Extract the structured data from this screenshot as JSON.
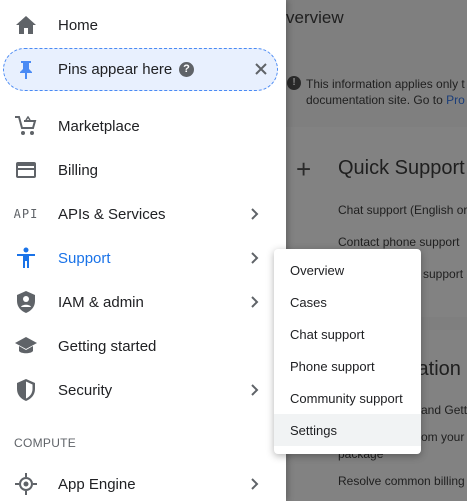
{
  "background": {
    "page_title": "verview",
    "info_line1": "This information applies only t",
    "info_line2": "documentation site. Go to",
    "info_link": "Pro",
    "quick_support_title": "Quick Support",
    "lines": [
      "Chat support (English or",
      "Contact phone support",
      "support",
      "and Gett",
      "om your C",
      "package",
      "Resolve common billing"
    ],
    "doc_title": "tation"
  },
  "sidebar": {
    "items_top": [
      {
        "label": "Home",
        "icon": "home-icon"
      }
    ],
    "pins": {
      "label": "Pins appear here",
      "help": "?",
      "close": "×"
    },
    "items": [
      {
        "label": "Marketplace",
        "icon": "cart-icon",
        "chevron": false
      },
      {
        "label": "Billing",
        "icon": "billing-icon",
        "chevron": false
      },
      {
        "label": "APIs & Services",
        "icon": "api-icon",
        "chevron": true
      },
      {
        "label": "Support",
        "icon": "support-icon",
        "chevron": true,
        "active": true
      },
      {
        "label": "IAM & admin",
        "icon": "iam-shield-icon",
        "chevron": true
      },
      {
        "label": "Getting started",
        "icon": "graduation-cap-icon",
        "chevron": false
      },
      {
        "label": "Security",
        "icon": "security-shield-icon",
        "chevron": true
      }
    ],
    "section_compute": "COMPUTE",
    "compute_items": [
      {
        "label": "App Engine",
        "icon": "app-engine-icon",
        "chevron": true
      }
    ],
    "api_text": "API"
  },
  "submenu": {
    "items": [
      "Overview",
      "Cases",
      "Chat support",
      "Phone support",
      "Community support",
      "Settings"
    ],
    "hovered": "Settings"
  },
  "colors": {
    "accent": "#1a73e8",
    "icon_gray": "#5f6368",
    "pins_bg": "#e8f0fe"
  }
}
